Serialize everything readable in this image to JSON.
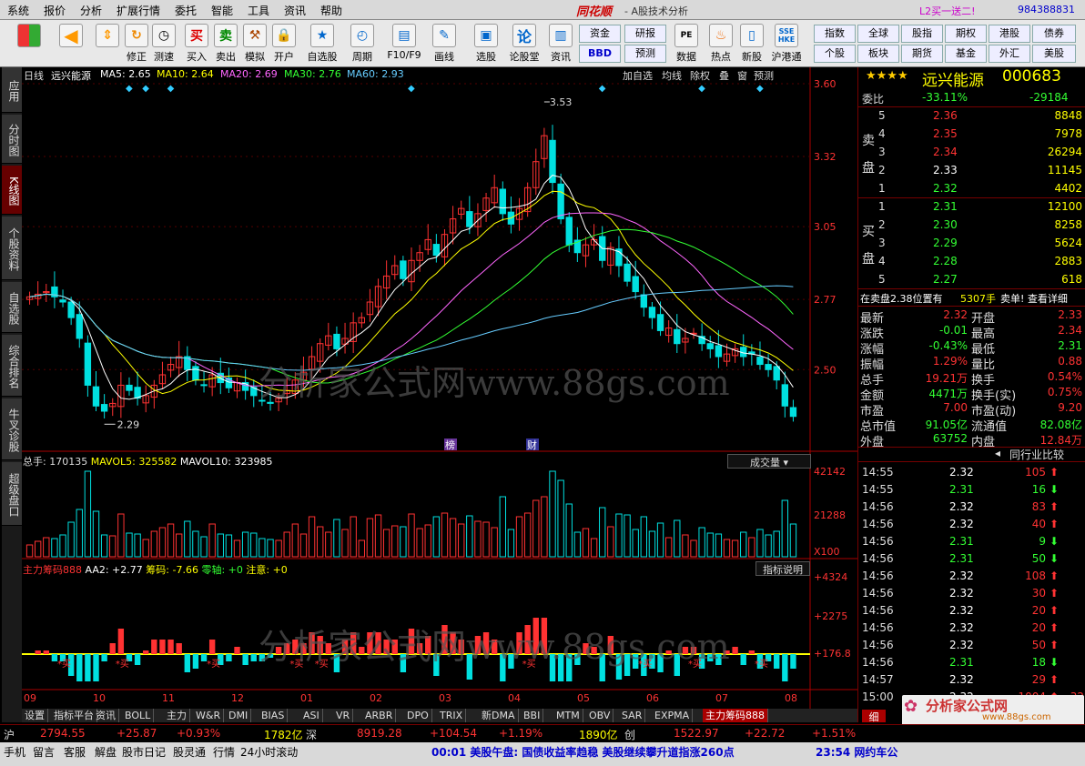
{
  "menubar": {
    "items": [
      "系统",
      "报价",
      "分析",
      "扩展行情",
      "委托",
      "智能",
      "工具",
      "资讯",
      "帮助"
    ],
    "brand": "同花顺",
    "subtitle": "- A股技术分析",
    "promo": "L2买一送二!",
    "account": "984388831"
  },
  "toolbar": {
    "buttons": [
      "修正",
      "测速",
      "买入",
      "卖出",
      "模拟",
      "开户",
      "自选股",
      "周期",
      "F10/F9",
      "画线",
      "选股",
      "论股堂",
      "资讯",
      "数据",
      "热点",
      "新股",
      "沪港通"
    ],
    "nav": [
      "资金",
      "研报",
      "BBD",
      "预测"
    ],
    "right": [
      "指数",
      "全球",
      "股指",
      "期权",
      "港股",
      "债券",
      "个股",
      "板块",
      "期货",
      "基金",
      "外汇",
      "美股"
    ]
  },
  "left_tabs": [
    "应用",
    "分时图",
    "K线图",
    "个股资料",
    "自选股",
    "综合排名",
    "牛叉诊股",
    "超级盘口"
  ],
  "chart_header": {
    "period": "日线",
    "name": "远兴能源",
    "ma5": "MA5: 2.65",
    "ma10": "MA10: 2.64",
    "ma20": "MA20: 2.69",
    "ma30": "MA30: 2.76",
    "ma60": "MA60: 2.93",
    "actions": [
      "加自选",
      "均线",
      "除权",
      "叠",
      "窗",
      "预测"
    ]
  },
  "chart_data": [
    {
      "type": "candlestick",
      "title": "日线",
      "ylim": [
        2.2,
        3.6
      ],
      "y_ticks": [
        "3.60",
        "3.32",
        "3.05",
        "2.77",
        "2.50"
      ],
      "annotations": [
        "3.53",
        "2.29",
        "榜",
        "财"
      ],
      "close": [
        2.78,
        2.79,
        2.8,
        2.78,
        2.76,
        2.7,
        2.62,
        2.44,
        2.36,
        2.34,
        2.37,
        2.44,
        2.42,
        2.39,
        2.4,
        2.44,
        2.48,
        2.52,
        2.55,
        2.5,
        2.46,
        2.44,
        2.48,
        2.45,
        2.43,
        2.45,
        2.42,
        2.4,
        2.38,
        2.37,
        2.39,
        2.42,
        2.46,
        2.49,
        2.55,
        2.6,
        2.63,
        2.58,
        2.62,
        2.68,
        2.7,
        2.76,
        2.82,
        2.86,
        2.9,
        2.85,
        2.92,
        2.95,
        3.0,
        2.94,
        3.02,
        3.08,
        3.12,
        3.05,
        3.1,
        3.16,
        3.2,
        3.1,
        3.06,
        3.12,
        3.2,
        3.3,
        3.4,
        3.22,
        3.08,
        2.98,
        2.95,
        2.98,
        3.0,
        2.92,
        2.97,
        2.9,
        2.84,
        2.8,
        2.74,
        2.7,
        2.65,
        2.66,
        2.6,
        2.62,
        2.64,
        2.6,
        2.58,
        2.55,
        2.56,
        2.58,
        2.55,
        2.56,
        2.52,
        2.5,
        2.46,
        2.36,
        2.32
      ],
      "ma_series": [
        "MA5",
        "MA10",
        "MA20",
        "MA30",
        "MA60"
      ]
    },
    {
      "type": "bar",
      "title": "总手",
      "header": [
        "总手: 170135",
        "MAVOL5: 325582",
        "MAVOL10: 323985"
      ],
      "y_ticks": [
        "42142",
        "21288",
        "X100"
      ],
      "selector": "成交量"
    },
    {
      "type": "bar",
      "title": "主力筹码888",
      "header": [
        "主力筹码888",
        "AA2: +2.77",
        "筹码: -7.66",
        "零轴: +0",
        "注意: +0"
      ],
      "y_ticks": [
        "+4324",
        "+2275",
        "+176.8"
      ],
      "button": "指标说明",
      "labels": [
        "买"
      ],
      "x_ticks": [
        "09",
        "10",
        "11",
        "12",
        "01",
        "02",
        "03",
        "04",
        "05",
        "06",
        "07",
        "08"
      ]
    }
  ],
  "bottom_tabs": [
    "设置",
    "指标平台",
    "资讯",
    "BOLL",
    "主力",
    "W&R",
    "DMI",
    "BIAS",
    "ASI",
    "VR",
    "ARBR",
    "DPO",
    "TRIX",
    "新DMA",
    "BBI",
    "MTM",
    "OBV",
    "SAR",
    "EXPMA",
    "主力筹码888"
  ],
  "quote": {
    "stars": "★★★★",
    "name": "远兴能源",
    "code": "000683",
    "weibi_label": "委比",
    "weibi": "-33.11%",
    "weicha": "-29184",
    "sell_label": "卖盘",
    "buy_label": "买盘",
    "sell": [
      [
        "5",
        "2.36",
        "8848"
      ],
      [
        "4",
        "2.35",
        "7978"
      ],
      [
        "3",
        "2.34",
        "26294"
      ],
      [
        "2",
        "2.33",
        "11145"
      ],
      [
        "1",
        "2.32",
        "4402"
      ]
    ],
    "buy": [
      [
        "1",
        "2.31",
        "12100"
      ],
      [
        "2",
        "2.30",
        "8258"
      ],
      [
        "3",
        "2.29",
        "5624"
      ],
      [
        "4",
        "2.28",
        "2883"
      ],
      [
        "5",
        "2.27",
        "618"
      ]
    ],
    "notice": "在卖盘2.38位置有",
    "notice_vol": "5307手",
    "notice_tail": "卖单! 查看详细",
    "stats": [
      [
        "最新",
        "2.32",
        "开盘",
        "2.33"
      ],
      [
        "涨跌",
        "-0.01",
        "最高",
        "2.34"
      ],
      [
        "涨幅",
        "-0.43%",
        "最低",
        "2.31"
      ],
      [
        "振幅",
        "1.29%",
        "量比",
        "0.88"
      ],
      [
        "总手",
        "19.21万",
        "换手",
        "0.54%"
      ],
      [
        "金额",
        "4471万",
        "换手(实)",
        "0.75%"
      ],
      [
        "市盈",
        "7.00",
        "市盈(动)",
        "9.20"
      ],
      [
        "总市值",
        "91.05亿",
        "流通值",
        "82.08亿"
      ],
      [
        "外盘",
        "63752",
        "内盘",
        "12.84万"
      ]
    ],
    "peer_label": "同行业比较",
    "ticks": [
      [
        "14:55",
        "2.32",
        "105",
        "up"
      ],
      [
        "14:55",
        "2.31",
        "16",
        "down"
      ],
      [
        "14:56",
        "2.32",
        "83",
        "up"
      ],
      [
        "14:56",
        "2.32",
        "40",
        "up"
      ],
      [
        "14:56",
        "2.31",
        "9",
        "down"
      ],
      [
        "14:56",
        "2.31",
        "50",
        "down"
      ],
      [
        "14:56",
        "2.32",
        "108",
        "up"
      ],
      [
        "14:56",
        "2.32",
        "30",
        "up"
      ],
      [
        "14:56",
        "2.32",
        "20",
        "up"
      ],
      [
        "14:56",
        "2.32",
        "20",
        "up"
      ],
      [
        "14:56",
        "2.32",
        "50",
        "up"
      ],
      [
        "14:56",
        "2.31",
        "18",
        "down"
      ],
      [
        "14:57",
        "2.32",
        "29",
        "up"
      ],
      [
        "15:00",
        "2.32",
        "1004",
        "up"
      ]
    ],
    "last_col": "32",
    "detail_tab": "细"
  },
  "index_bar": {
    "sh_label": "沪",
    "sh_val": "2794.55",
    "sh_chg": "+25.87",
    "sh_pct": "+0.93%",
    "sh_amt": "1782亿",
    "sz_label": "深",
    "sz_val": "8919.28",
    "sz_chg": "+104.54",
    "sz_pct": "+1.19%",
    "sz_amt": "1890亿",
    "cy_label": "创",
    "cy_val": "1522.97",
    "cy_chg": "+22.72",
    "cy_pct": "+1.51%"
  },
  "status": {
    "tabs": [
      "手机",
      "留言",
      "客服",
      "解盘",
      "股市日记",
      "股灵通",
      "行情",
      "24小时滚动"
    ],
    "news1": "00:01 美股午盘: 国债收益率趋稳 美股继续攀升道指涨260点",
    "news2": "23:54 网约车公",
    "watermark": "分析家公式网www.88gs.com",
    "logo_text": "分析家公式网",
    "logo_url": "www.88gs.com"
  },
  "colors": {
    "up": "#ff3232",
    "down": "#00e0e0",
    "ma5": "#ffffff",
    "ma10": "#ffff00",
    "ma20": "#ff66ff",
    "ma30": "#33ff33",
    "ma60": "#66ccff"
  }
}
